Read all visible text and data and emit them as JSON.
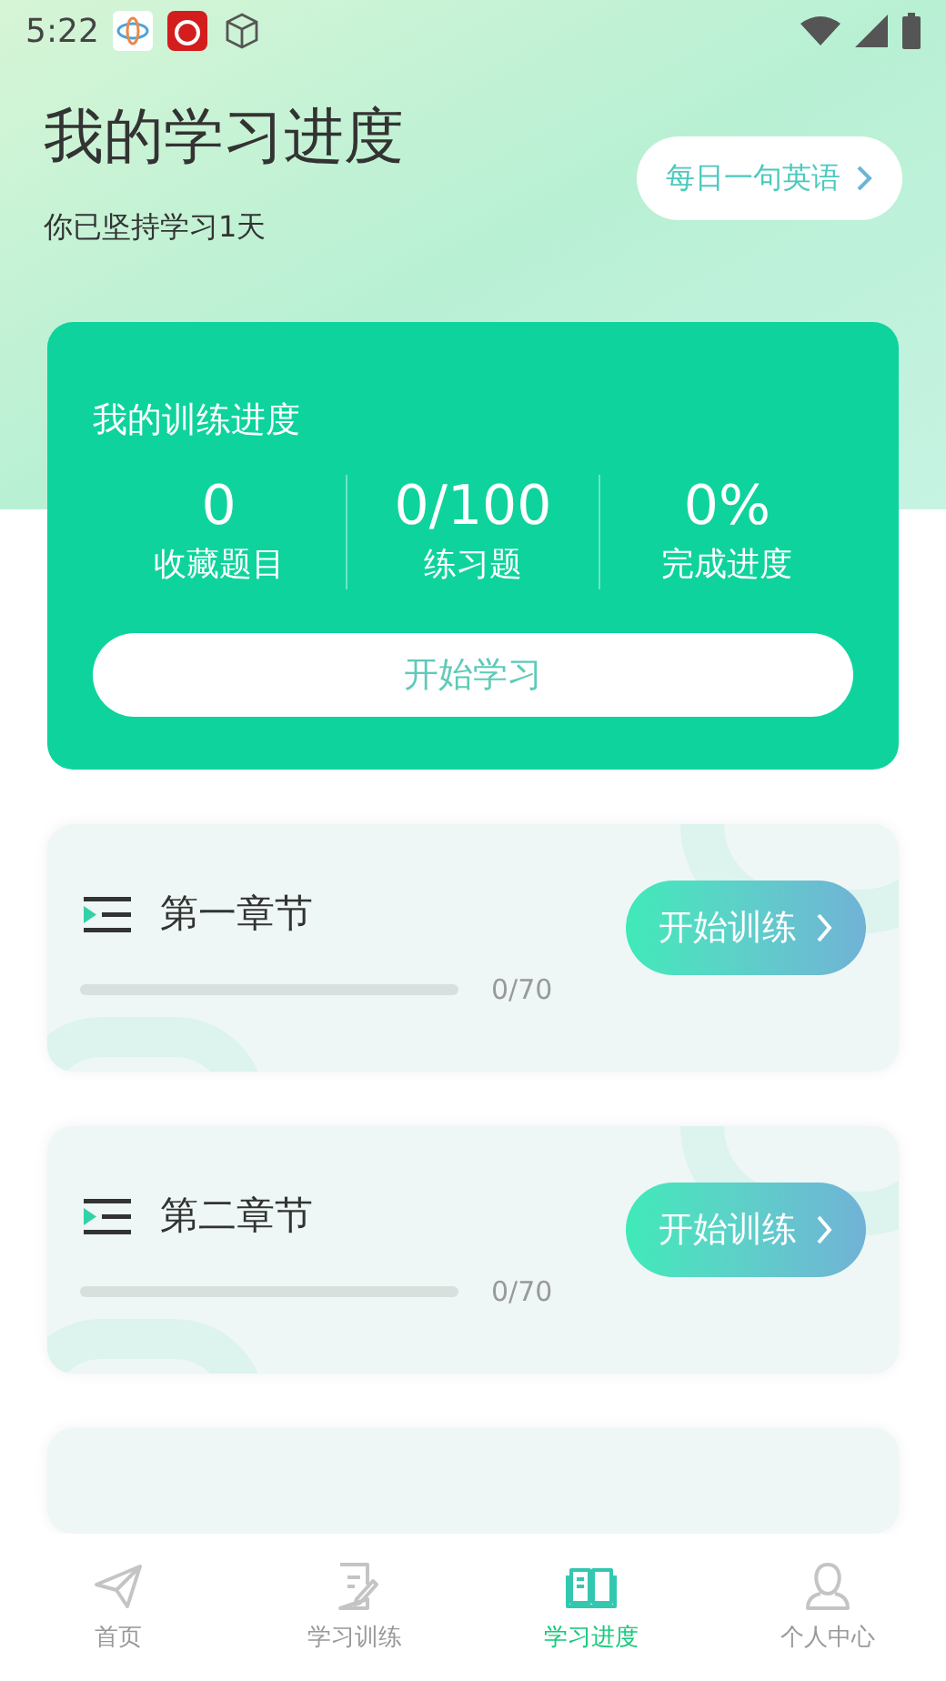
{
  "status_bar": {
    "time": "5:22"
  },
  "header": {
    "title": "我的学习进度",
    "subtitle": "你已坚持学习1天",
    "daily_button": "每日一句英语"
  },
  "progress_card": {
    "title": "我的训练进度",
    "stats": [
      {
        "value": "0",
        "label": "收藏题目"
      },
      {
        "value": "0/100",
        "label": "练习题"
      },
      {
        "value": "0%",
        "label": "完成进度"
      }
    ],
    "start_button": "开始学习"
  },
  "chapters": [
    {
      "title": "第一章节",
      "level": 0,
      "count": "0/70",
      "button": "开始训练"
    },
    {
      "title": "第二章节",
      "level": 0,
      "count": "0/70",
      "button": "开始训练"
    }
  ],
  "bottom_nav": [
    {
      "label": "首页",
      "kind": "send",
      "selected": false
    },
    {
      "label": "学习训练",
      "kind": "edit",
      "selected": false
    },
    {
      "label": "学习进度",
      "kind": "book",
      "selected": true
    },
    {
      "label": "个人中心",
      "kind": "user",
      "selected": false
    }
  ]
}
